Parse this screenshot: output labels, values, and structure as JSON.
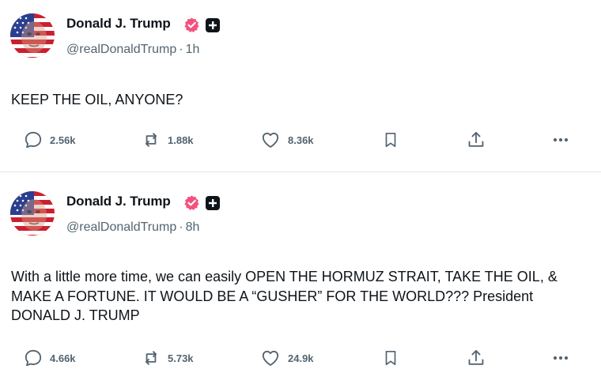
{
  "posts": [
    {
      "author": {
        "name": "Donald J. Trump",
        "handle": "@realDonaldTrump",
        "time": "1h",
        "avatar_icon": "flag-face-avatar",
        "verified_icon": "verified-badge-icon",
        "affiliate_icon": "plus-badge-icon"
      },
      "text": "KEEP THE OIL, ANYONE?",
      "actions": {
        "replies": "2.56k",
        "reposts": "1.88k",
        "likes": "8.36k"
      }
    },
    {
      "author": {
        "name": "Donald J. Trump",
        "handle": "@realDonaldTrump",
        "time": "8h",
        "avatar_icon": "flag-face-avatar",
        "verified_icon": "verified-badge-icon",
        "affiliate_icon": "plus-badge-icon"
      },
      "text": "With a little more time, we can easily OPEN THE HORMUZ STRAIT, TAKE THE OIL, & MAKE A FORTUNE. IT WOULD BE A “GUSHER” FOR THE WORLD??? President DONALD J. TRUMP",
      "actions": {
        "replies": "4.66k",
        "reposts": "5.73k",
        "likes": "24.9k"
      }
    }
  ],
  "separator": "·",
  "colors": {
    "text": "#0f1419",
    "secondary": "#536471",
    "verified": "#f4527e",
    "divider": "#e6e6e6"
  }
}
